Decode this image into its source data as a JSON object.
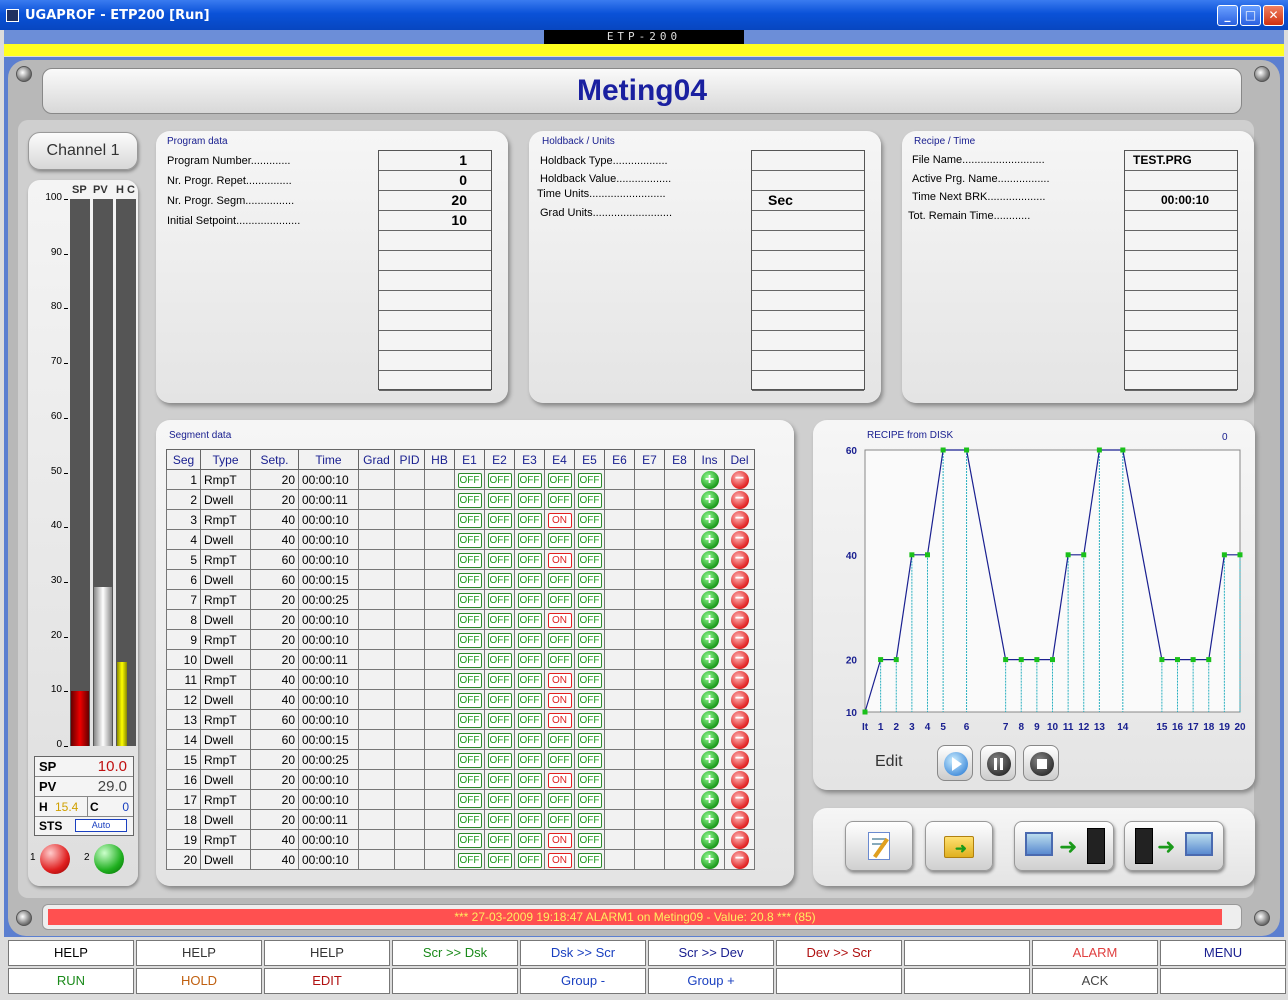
{
  "window": {
    "title": "UGAPROF - ETP200 [Run]",
    "banner": "ETP-200"
  },
  "page_title": "Meting04",
  "channel": {
    "label": "Channel  1"
  },
  "bars": {
    "headers": [
      "SP",
      "PV",
      "H C"
    ],
    "ticks": [
      "100",
      "90",
      "80",
      "70",
      "60",
      "50",
      "40",
      "30",
      "20",
      "10",
      "0"
    ],
    "sp_level": 10,
    "pv_level": 29,
    "h_level": 15.4
  },
  "readouts": {
    "sp_label": "SP",
    "sp_value": "10.0",
    "pv_label": "PV",
    "pv_value": "29.0",
    "h_label": "H",
    "h_value": "15.4",
    "c_label": "C",
    "c_value": "0",
    "sts_label": "STS",
    "sts_value": "Auto",
    "led1": "1",
    "led2": "2"
  },
  "program": {
    "title": "Program data",
    "labels": [
      "Program Number.............",
      "Nr. Progr. Repet...............",
      "Nr. Progr. Segm................",
      "Initial Setpoint....................."
    ],
    "values": [
      "1",
      "0",
      "20",
      "10"
    ]
  },
  "holdback": {
    "title": "Holdback / Units",
    "labels": [
      "Holdback Type..................",
      "Holdback Value..................",
      "Time Units.........................",
      "Grad Units.........................."
    ],
    "values": [
      "",
      "",
      "Sec",
      ""
    ]
  },
  "recipe": {
    "title": "Recipe / Time",
    "labels": [
      "File Name...........................",
      "Active Prg. Name.................",
      "Time Next BRK...................",
      "Tot. Remain Time............"
    ],
    "values": [
      "TEST.PRG",
      "",
      "00:00:10",
      ""
    ]
  },
  "segment": {
    "title": "Segment data",
    "headers": [
      "Seg",
      "Type",
      "Setp.",
      "Time",
      "Grad",
      "PID",
      "HB",
      "E1",
      "E2",
      "E3",
      "E4",
      "E5",
      "E6",
      "E7",
      "E8",
      "Ins",
      "Del"
    ],
    "rows": [
      [
        "1",
        "RmpT",
        "20",
        "00:00:10",
        "OFF"
      ],
      [
        "2",
        "Dwell",
        "20",
        "00:00:11",
        "OFF"
      ],
      [
        "3",
        "RmpT",
        "40",
        "00:00:10",
        "ON"
      ],
      [
        "4",
        "Dwell",
        "40",
        "00:00:10",
        "OFF"
      ],
      [
        "5",
        "RmpT",
        "60",
        "00:00:10",
        "ON"
      ],
      [
        "6",
        "Dwell",
        "60",
        "00:00:15",
        "OFF"
      ],
      [
        "7",
        "RmpT",
        "20",
        "00:00:25",
        "OFF"
      ],
      [
        "8",
        "Dwell",
        "20",
        "00:00:10",
        "ON"
      ],
      [
        "9",
        "RmpT",
        "20",
        "00:00:10",
        "OFF"
      ],
      [
        "10",
        "Dwell",
        "20",
        "00:00:11",
        "OFF"
      ],
      [
        "11",
        "RmpT",
        "40",
        "00:00:10",
        "ON"
      ],
      [
        "12",
        "Dwell",
        "40",
        "00:00:10",
        "ON"
      ],
      [
        "13",
        "RmpT",
        "60",
        "00:00:10",
        "ON"
      ],
      [
        "14",
        "Dwell",
        "60",
        "00:00:15",
        "OFF"
      ],
      [
        "15",
        "RmpT",
        "20",
        "00:00:25",
        "OFF"
      ],
      [
        "16",
        "Dwell",
        "20",
        "00:00:10",
        "ON"
      ],
      [
        "17",
        "RmpT",
        "20",
        "00:00:10",
        "OFF"
      ],
      [
        "18",
        "Dwell",
        "20",
        "00:00:11",
        "OFF"
      ],
      [
        "19",
        "RmpT",
        "40",
        "00:00:10",
        "ON"
      ],
      [
        "20",
        "Dwell",
        "40",
        "00:00:10",
        "ON"
      ]
    ],
    "off_text": "OFF",
    "on_text": "ON"
  },
  "chart_data": {
    "type": "line",
    "title": "RECIPE from DISK",
    "counter": "0",
    "ylim": [
      10,
      60
    ],
    "yticks": [
      "60",
      "40",
      "20",
      "10"
    ],
    "x": [
      "It",
      "1",
      "2",
      "3",
      "4",
      "5",
      "6",
      "7",
      "8",
      "9",
      "10",
      "11",
      "12",
      "13",
      "14",
      "15",
      "16",
      "17",
      "18",
      "19",
      "20"
    ],
    "values": [
      10,
      20,
      20,
      40,
      40,
      60,
      60,
      20,
      20,
      20,
      20,
      40,
      40,
      60,
      60,
      20,
      20,
      20,
      20,
      40,
      40
    ],
    "x_pos": [
      0,
      1,
      2,
      3,
      4,
      5,
      6.5,
      9,
      10,
      11,
      12,
      13,
      14,
      15,
      16.5,
      19,
      20,
      21,
      22,
      23,
      24
    ]
  },
  "edit_label": "Edit",
  "alarm_text": "*** 27-03-2009 19:18:47   ALARM1 on Meting09 - Value: 20.8 *** (85)",
  "fkeys": [
    {
      "label": "HELP",
      "color": "#000000"
    },
    {
      "label": "HELP",
      "color": "#333333"
    },
    {
      "label": "HELP",
      "color": "#333333"
    },
    {
      "label": "Scr >> Dsk",
      "color": "#1a8a1a"
    },
    {
      "label": "Dsk >> Scr",
      "color": "#1a40c0"
    },
    {
      "label": "Scr >> Dev",
      "color": "#1a2090"
    },
    {
      "label": "Dev >> Scr",
      "color": "#b01010"
    },
    {
      "label": "",
      "color": "#000000"
    },
    {
      "label": "ALARM",
      "color": "#e04040"
    },
    {
      "label": "MENU",
      "color": "#1a2090"
    },
    {
      "label": "RUN",
      "color": "#1a8a1a"
    },
    {
      "label": "HOLD",
      "color": "#c06010"
    },
    {
      "label": "EDIT",
      "color": "#b01010"
    },
    {
      "label": "",
      "color": "#000000"
    },
    {
      "label": "Group -",
      "color": "#1a40c0"
    },
    {
      "label": "Group +",
      "color": "#1a40c0"
    },
    {
      "label": "",
      "color": "#000000"
    },
    {
      "label": "",
      "color": "#000000"
    },
    {
      "label": "ACK",
      "color": "#444444"
    },
    {
      "label": "",
      "color": "#000000"
    }
  ]
}
